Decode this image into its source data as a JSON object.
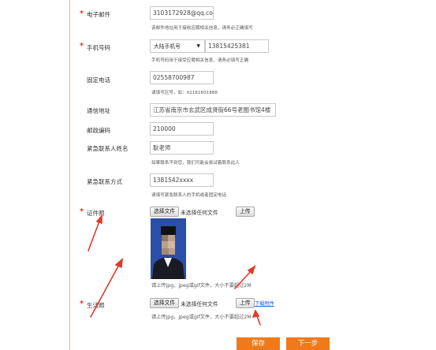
{
  "form": {
    "email": {
      "label": "电子邮件",
      "value": "3103172928@qq.com",
      "hint": "该邮件地址用于接收应聘相关信息，请务必正确填写"
    },
    "mobile": {
      "label": "手机号码",
      "region_select": "大陆手机号",
      "value": "13815425381",
      "hint": "手机号码用于接受应聘相关信息，请务必填写正确"
    },
    "landline": {
      "label": "固定电话",
      "value": "02558700987",
      "hint": "请填写区号，如：02161601888"
    },
    "address": {
      "label": "通信地址",
      "value": "江苏省南京市玄武区成贤街66号老图书馆4楼"
    },
    "postcode": {
      "label": "邮政编码",
      "value": "210000"
    },
    "emergency_name": {
      "label": "紧急联系人姓名",
      "value": "耿老师",
      "hint": "如果联系不到您，我们可能会尝试着联系此人"
    },
    "emergency_phone": {
      "label": "紧急联系方式",
      "value": "1381542xxxx",
      "hint": "请填写紧急联系人的手机或者固定电话"
    },
    "id_photo": {
      "label": "证件照",
      "choose_button": "选择文件",
      "file_status": "未选择任何文件",
      "upload_button": "上传",
      "hint": "请上传jpg，jpeg或gif文件，大小不要超过2M"
    },
    "life_photo": {
      "label": "生活照",
      "choose_button": "选择文件",
      "file_status": "未选择任何文件",
      "upload_button": "上传",
      "download_link": "下载附件",
      "hint": "请上传jpg，jpeg或gif文件，大小不要超过2M"
    },
    "required_mark": "*"
  },
  "actions": {
    "save": "保存",
    "next": "下一步"
  },
  "colors": {
    "accent_orange": "#f07a19",
    "required_red": "#e4392a",
    "annotation_red": "#e23a2a",
    "divider": "#f0b48a",
    "link_blue": "#1a5bd6",
    "photo_bg": "#2b4fa8"
  }
}
